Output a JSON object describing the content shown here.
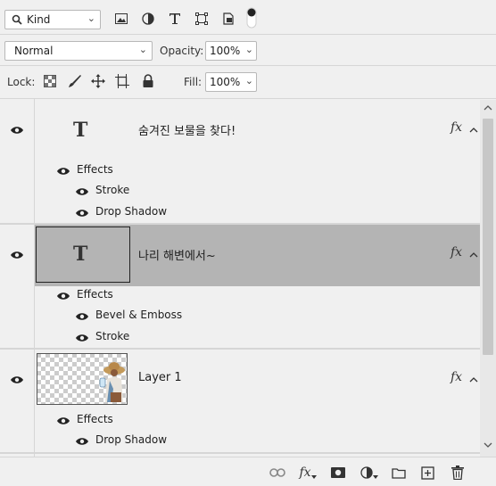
{
  "toolbar": {
    "filter_value": "Kind",
    "filter_icons": [
      "image-filter-icon",
      "adjustment-filter-icon",
      "type-filter-icon",
      "shape-filter-icon",
      "smart-object-filter-icon",
      "filter-toggle-icon"
    ]
  },
  "blend": {
    "mode": "Normal",
    "opacity_label": "Opacity:",
    "opacity_value": "100%"
  },
  "lock": {
    "label": "Lock:",
    "fill_label": "Fill:",
    "fill_value": "100%"
  },
  "layers": [
    {
      "type": "text",
      "name": "숨겨진 보물을 찾다!",
      "thumbnail_glyph": "T",
      "selected": false,
      "fx": "fx",
      "effects_label": "Effects",
      "effects": [
        "Stroke",
        "Drop Shadow"
      ]
    },
    {
      "type": "text",
      "name": "나리 해변에서~",
      "thumbnail_glyph": "T",
      "selected": true,
      "fx": "fx",
      "effects_label": "Effects",
      "effects": [
        "Bevel & Emboss",
        "Stroke"
      ]
    },
    {
      "type": "pixel",
      "name": "Layer 1",
      "selected": false,
      "fx": "fx",
      "effects_label": "Effects",
      "effects": [
        "Drop Shadow"
      ]
    }
  ],
  "bottom": {
    "fx": "fx",
    "icons": [
      "link-layers-icon",
      "fx-icon",
      "add-mask-icon",
      "new-adjustment-icon",
      "new-group-icon",
      "new-layer-icon",
      "delete-layer-icon"
    ]
  },
  "colors": {
    "panel_bg": "#f0f0f0",
    "selected_row": "#b4b4b4",
    "selected_thumb_bg": "#b4b4b4"
  }
}
